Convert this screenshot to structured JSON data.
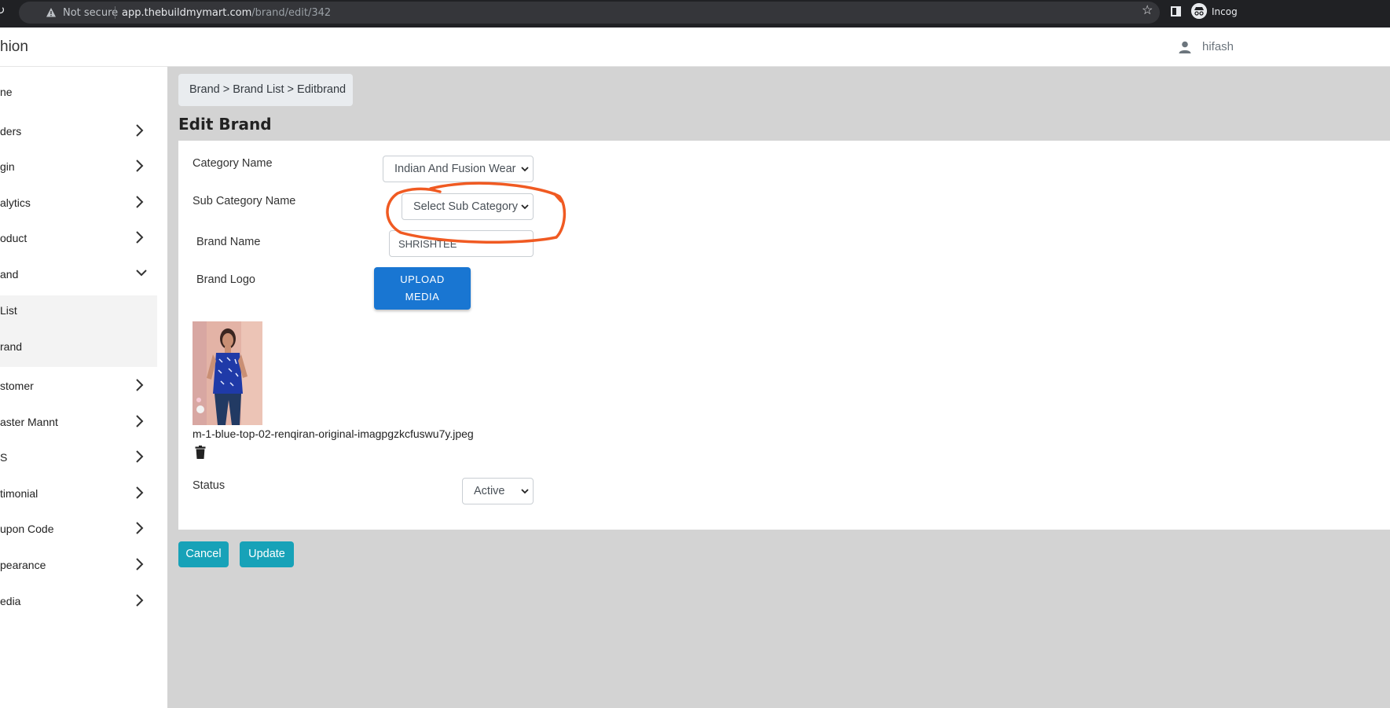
{
  "browser": {
    "security_label": "Not secure",
    "url_host": "app.thebuildmymart.com",
    "url_path": "/brand/edit/342",
    "profile_label": "Incog"
  },
  "header": {
    "brand_title": "hion",
    "user_name": "hifash"
  },
  "sidebar": {
    "items": [
      {
        "label": "ne"
      },
      {
        "label": "ders"
      },
      {
        "label": "gin"
      },
      {
        "label": "alytics"
      },
      {
        "label": "oduct"
      },
      {
        "label": "and"
      },
      {
        "label": "List"
      },
      {
        "label": "rand"
      },
      {
        "label": "stomer"
      },
      {
        "label": "aster Mannt"
      },
      {
        "label": "S"
      },
      {
        "label": "timonial"
      },
      {
        "label": "upon Code"
      },
      {
        "label": "pearance"
      },
      {
        "label": "edia"
      }
    ]
  },
  "breadcrumb": "Brand > Brand List > Editbrand",
  "page_title": "Edit Brand",
  "form": {
    "category_label": "Category Name",
    "category_value": "Indian And Fusion Wear",
    "subcategory_label": "Sub Category Name",
    "subcategory_value": "Select Sub Category",
    "brand_name_label": "Brand Name",
    "brand_name_value": "SHRISHTEE",
    "brand_logo_label": "Brand Logo",
    "upload_line1": "UPLOAD",
    "upload_line2": "MEDIA",
    "file_name": "m-1-blue-top-02-renqiran-original-imagpgzkcfuswu7y.jpeg",
    "status_label": "Status",
    "status_value": "Active"
  },
  "actions": {
    "cancel_label": "Cancel",
    "update_label": "Update"
  },
  "colors": {
    "primary_button": "#1976d2",
    "action_button": "#17a2b8",
    "annotation": "#f05a22",
    "content_bg": "#d3d3d3"
  }
}
